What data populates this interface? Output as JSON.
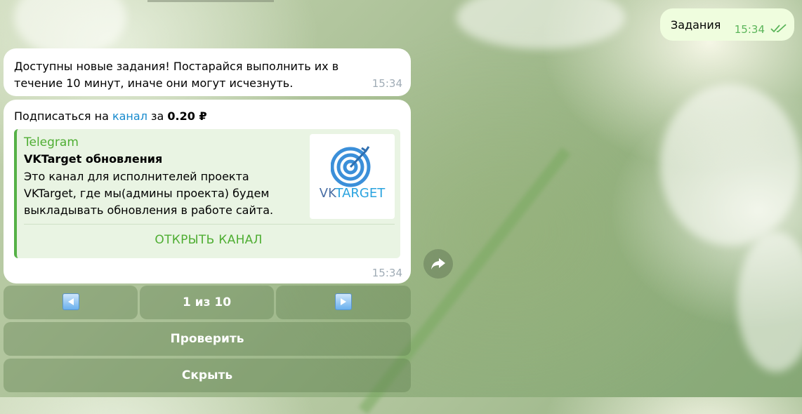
{
  "outgoing": {
    "text": "Задания",
    "time": "15:34"
  },
  "message1": {
    "text_line1": "Доступны новые задания! Постарайся выполнить их в",
    "text_line2": "течение 10 минут, иначе они могут исчезнуть.",
    "time": "15:34"
  },
  "message2": {
    "prefix": "Подписаться на ",
    "link": "канал",
    "middle": " за ",
    "price": "0.20 ₽",
    "time": "15:34",
    "preview": {
      "site": "Telegram",
      "title": "VKTarget обновления",
      "desc_line1": "Это канал для исполнителей проекта",
      "desc_line2": "VKTarget, где мы(админы проекта) будем",
      "desc_line3": "выкладывать обновления в работе сайта.",
      "brand_part1": "VK",
      "brand_part2": "TARGET",
      "button": "ОТКРЫТЬ КАНАЛ"
    }
  },
  "keyboard": {
    "page": "1 из 10",
    "check": "Проверить",
    "hide": "Скрыть"
  },
  "colors": {
    "accent_green": "#4fae33",
    "link_blue": "#168acd",
    "outgoing_bg": "#effdde"
  },
  "icons": {
    "prev": "left-arrow-icon",
    "next": "right-arrow-icon",
    "share": "share-icon",
    "ticks": "double-check-icon"
  }
}
